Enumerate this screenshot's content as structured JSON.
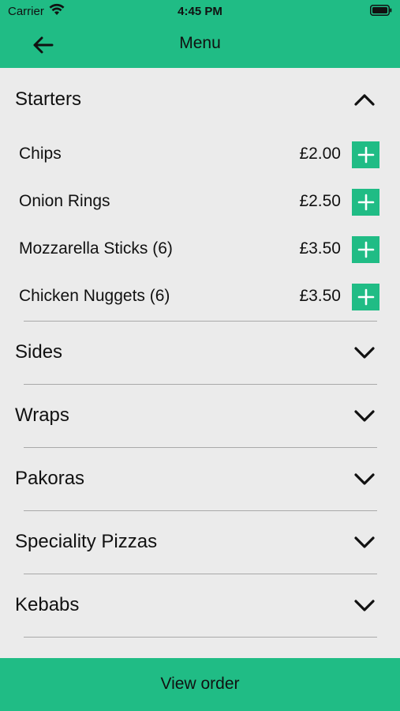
{
  "colors": {
    "accent": "#20bc85",
    "background": "#ebebeb",
    "divider": "#a9a9a9"
  },
  "status_bar": {
    "carrier": "Carrier",
    "time": "4:45 PM"
  },
  "header": {
    "title": "Menu",
    "back_icon": "arrow-left-icon"
  },
  "sections": [
    {
      "title": "Starters",
      "expanded": true,
      "items": [
        {
          "name": "Chips",
          "price": "£2.00"
        },
        {
          "name": "Onion Rings",
          "price": "£2.50"
        },
        {
          "name": "Mozzarella Sticks (6)",
          "price": "£3.50"
        },
        {
          "name": "Chicken Nuggets (6)",
          "price": "£3.50"
        }
      ]
    },
    {
      "title": "Sides",
      "expanded": false
    },
    {
      "title": "Wraps",
      "expanded": false
    },
    {
      "title": "Pakoras",
      "expanded": false
    },
    {
      "title": "Speciality Pizzas",
      "expanded": false
    },
    {
      "title": "Kebabs",
      "expanded": false
    }
  ],
  "footer": {
    "view_order_label": "View order"
  }
}
